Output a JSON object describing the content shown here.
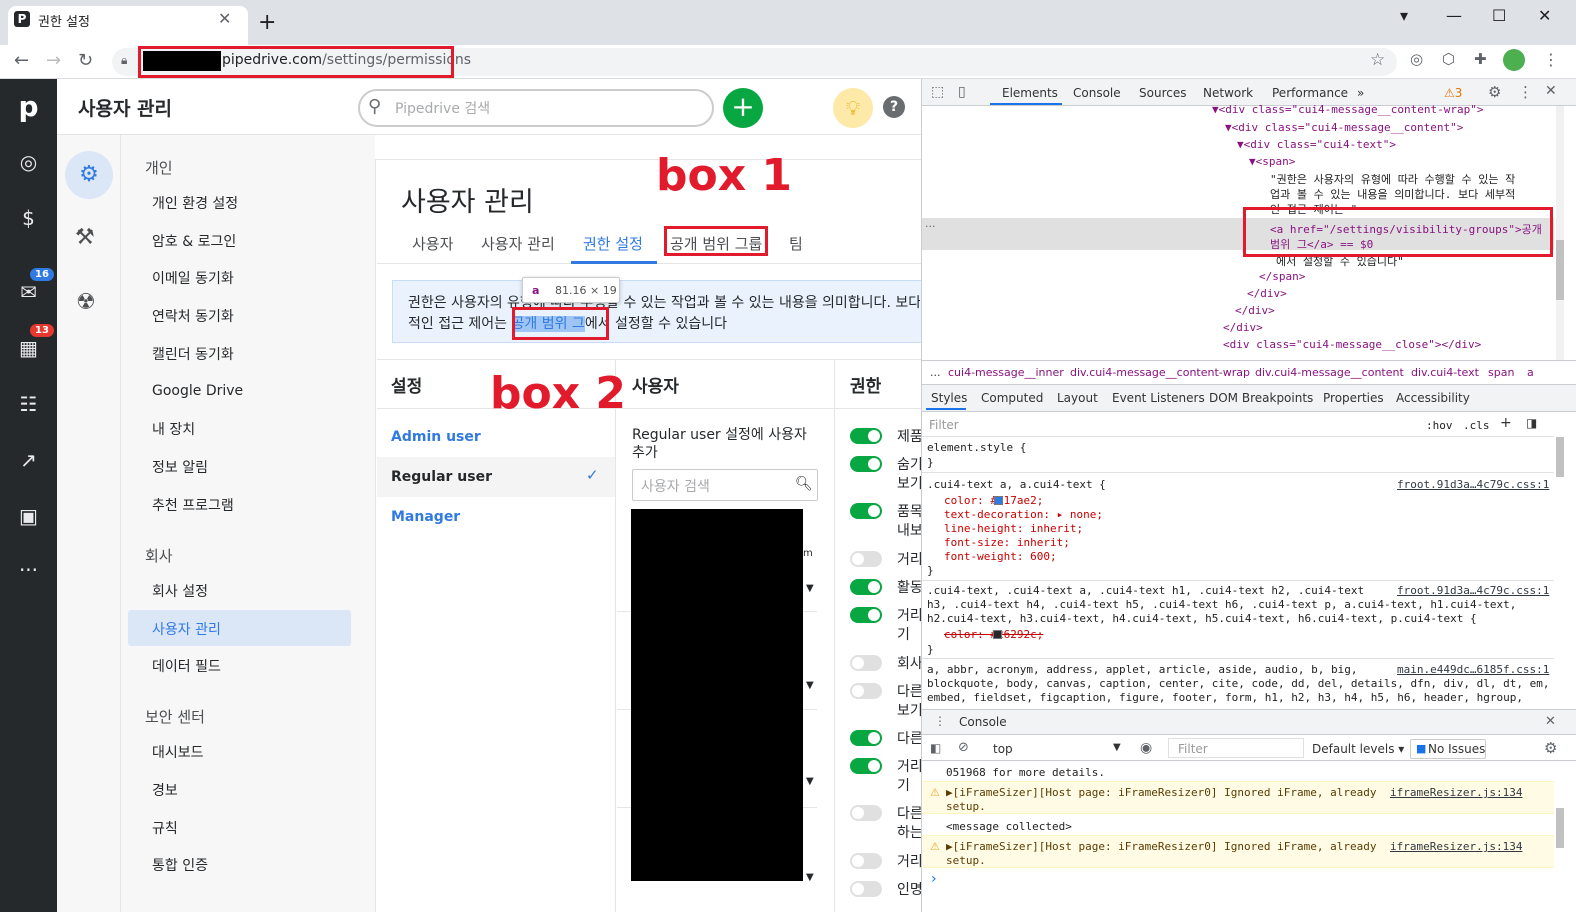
{
  "browser": {
    "tab_title": "권한 설정",
    "url_host": "pipedrive.com",
    "url_path": "/settings/permissions"
  },
  "header": {
    "title": "사용자 관리",
    "search_placeholder": "Pipedrive 검색",
    "add_label": "+",
    "help_label": "?"
  },
  "rail": {
    "mail_badge": "16",
    "calendar_badge": "13"
  },
  "nav": {
    "personal_heading": "개인",
    "personal_items": [
      "개인 환경 설정",
      "암호 & 로그인",
      "이메일 동기화",
      "연락처 동기화",
      "캘린더 동기화",
      "Google Drive",
      "내 장치",
      "정보 알림",
      "추천 프로그램"
    ],
    "company_heading": "회사",
    "company_items": [
      "회사 설정",
      "사용자 관리",
      "데이터 필드"
    ],
    "security_heading": "보안 센터",
    "security_items": [
      "대시보드",
      "경보",
      "규칙",
      "통합 인증"
    ]
  },
  "main": {
    "title": "사용자 관리",
    "tabs": [
      "사용자",
      "사용자 관리",
      "권한 설정",
      "공개 범위 그룹",
      "팀"
    ],
    "info_line1": "권한은 사용자의 유형에 따라 수행할 수 있는 작업과 볼 수 있는 내용을 의미합니다. 보다 세부",
    "info_line2_pre": "적인 접근 제어는 ",
    "info_link": "공개 범위 그",
    "info_line2_post": "에서 설정할 수 있습니다",
    "tooltip_tag": "a",
    "tooltip_size": "81.16 × 19",
    "annot_box1": "box 1",
    "annot_box2": "box 2",
    "col_settings": "설정",
    "col_users": "사용자",
    "col_perms": "권한",
    "roles": [
      "Admin user",
      "Regular user",
      "Manager"
    ],
    "check": "✓",
    "add_users_label": "Regular user 설정에 사용자 추가",
    "user_search_placeholder": "사용자 검색",
    "partial_m": "m",
    "permissions": [
      "제품",
      "숨기",
      "보기",
      "품목",
      "내보",
      "거리",
      "활동",
      "거리",
      "기",
      "회사",
      "다른",
      "보기",
      "다른",
      "거리",
      "기",
      "다른",
      "하는",
      "거리",
      "인명"
    ]
  },
  "devtools": {
    "tabs": [
      "Elements",
      "Console",
      "Sources",
      "Network",
      "Performance",
      "»"
    ],
    "warn_count": "⚠3",
    "dom": [
      "▼<div class=\"cui4-message__content-wrap\">",
      "▼<div class=\"cui4-message__content\">",
      "▼<div class=\"cui4-text\">",
      "▼<span>",
      "\"권한은 사용자의 유형에 따라 수행할 수 있는 작",
      "업과 볼 수 있는 내용을 의미합니다. 보다 세부적",
      "인 접근 제어는 \"",
      "<a href=\"/settings/visibility-groups\">공개",
      "범위 그</a> == $0",
      "에서 설정할 수 있습니다\"",
      "</span>",
      "</div>",
      "</div>",
      "</div>",
      "<div class=\"cui4-message__close\"></div>"
    ],
    "crumbs": [
      "...",
      "cui4-message__inner",
      "div.cui4-message__content-wrap",
      "div.cui4-message__content",
      "div.cui4-text",
      "span",
      "a"
    ],
    "style_tabs": [
      "Styles",
      "Computed",
      "Layout",
      "Event Listeners",
      "DOM Breakpoints",
      "Properties",
      "Accessibility"
    ],
    "filter_placeholder": "Filter",
    "hov": ":hov",
    "cls": ".cls",
    "rules": {
      "element_style": "element.style {",
      "close": "}",
      "r1_selector": ".cui4-text a, a.cui4-text {",
      "r1_src": "froot.91d3a…4c79c.css:1",
      "r1_props": [
        "color: #317ae2;",
        "text-decoration: ▸ none;",
        "line-height: inherit;",
        "font-size: inherit;",
        "font-weight: 600;"
      ],
      "r2_selector_1": ".cui4-text, .cui4-text a, .cui4-text h1, .cui4-text h2, .cui4-text",
      "r2_selector_2": "h3, .cui4-text h4, .cui4-text h5, .cui4-text h6, .cui4-text p, a.cui4-text, h1.cui4-text,",
      "r2_selector_3": "h2.cui4-text, h3.cui4-text, h4.cui4-text, h5.cui4-text, h6.cui4-text, p.cui4-text {",
      "r2_src": "froot.91d3a…4c79c.css:1",
      "r2_prop": "color: #26292c;",
      "r3_selector_1": "a, abbr, acronym, address, applet, article, aside, audio, b, big,",
      "r3_selector_2": "blockquote, body, canvas, caption, center, cite, code, dd, del, details, dfn, div, dl, dt, em,",
      "r3_selector_3": "embed, fieldset, figcaption, figure, footer, form, h1, h2, h3, h4, h5, h6, header, hgroup,",
      "r3_src": "main.e449dc…6185f.css:1"
    },
    "console": {
      "title": "Console",
      "context": "top",
      "filter": "Filter",
      "levels": "Default levels ▾",
      "issues": "No Issues",
      "line0": "051968 for more details.",
      "warn1_a": "▶[iFrameSizer][Host page: iFrameResizer0] Ignored iFrame, already",
      "warn1_b": "setup.",
      "warn1_src": "iframeResizer.js:134",
      "msg": "<message collected>",
      "warn2_a": "▶[iFrameSizer][Host page: iFrameResizer0] Ignored iFrame, already",
      "warn2_b": "setup.",
      "warn2_src": "iframeResizer.js:134",
      "prompt": "›"
    }
  },
  "colors": {
    "accent": "#317ae2",
    "green": "#08a742",
    "annotation_red": "#e21b2c",
    "rail": "#26292c"
  }
}
